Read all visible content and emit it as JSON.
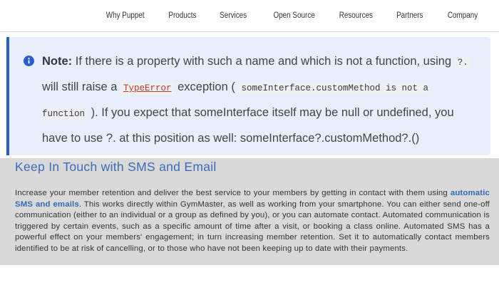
{
  "nav": {
    "items": [
      "Why Puppet",
      "Products",
      "Services",
      "Open Source",
      "Resources",
      "Partners",
      "Company"
    ]
  },
  "note": {
    "icon": "info-icon",
    "label": "Note:",
    "text_1": " If there is a property with such a name and which is not a function, using ",
    "code_1": "?.",
    "text_2": " will still raise a ",
    "code_link": "TypeError",
    "text_3": " exception ( ",
    "code_2": "someInterface.customMethod is not a function",
    "text_4": " ). If you expect that someInterface itself may be null or undefined, you have to use ?. at this position as well: someInterface?.customMethod?.()"
  },
  "sms": {
    "heading": "Keep In Touch with SMS and Email",
    "body_1": "Increase your member retention and deliver the best service to your members by getting in contact with them using ",
    "link": "automatic SMS and emails",
    "body_2": ". This works directly within GymMaster, as well as working from your smartphone. You can either send one-off communication (either to an individual or a group as defined by you), or you can automate contact. Automated communication is triggered by certain events, such as a specific amount of time after a visit, or booking a class online. Automated SMS has a powerful effect on your members' engagement; in turn increasing member retention. Set it to automatically contact members identified to be at risk of cancelling, or to those who have not been keeping up to date with their payments."
  },
  "colors": {
    "note_bg": "#e6effb",
    "note_border": "#2b5fc7",
    "section_bg": "#d9d9d9",
    "heading": "#3a6db5",
    "link": "#2e6db4"
  }
}
